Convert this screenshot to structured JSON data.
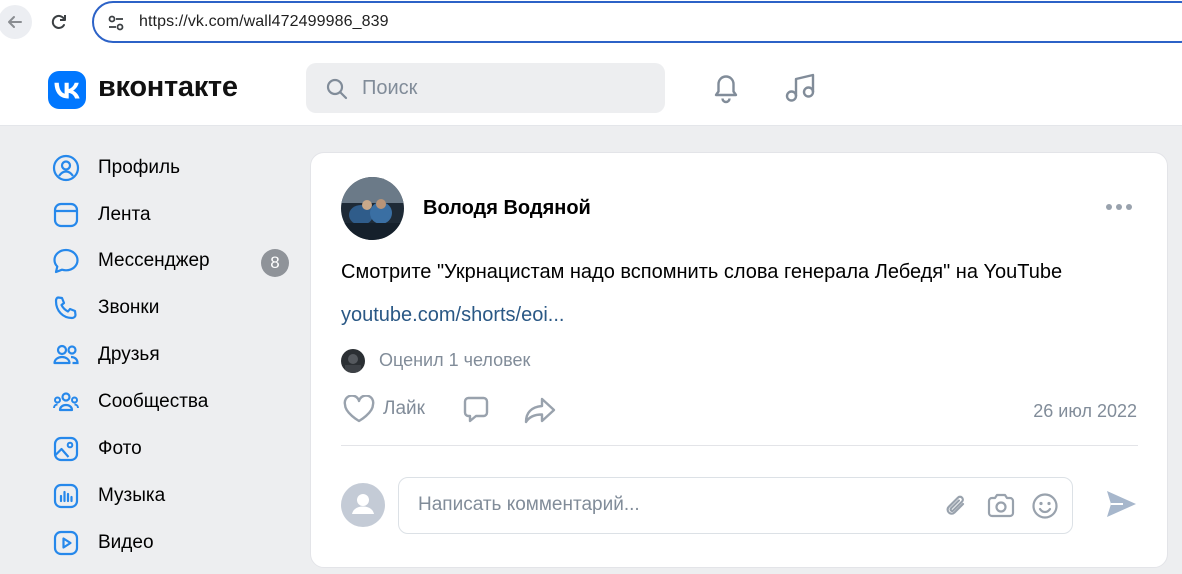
{
  "browser": {
    "url": "https://vk.com/wall472499986_839"
  },
  "header": {
    "brand": "вконтакте",
    "search_placeholder": "Поиск"
  },
  "sidebar": {
    "items": [
      {
        "label": "Профиль",
        "icon": "profile-icon"
      },
      {
        "label": "Лента",
        "icon": "feed-icon"
      },
      {
        "label": "Мессенджер",
        "icon": "messenger-icon",
        "badge": "8"
      },
      {
        "label": "Звонки",
        "icon": "phone-icon"
      },
      {
        "label": "Друзья",
        "icon": "friends-icon"
      },
      {
        "label": "Сообщества",
        "icon": "communities-icon"
      },
      {
        "label": "Фото",
        "icon": "photo-icon"
      },
      {
        "label": "Музыка",
        "icon": "music-icon"
      },
      {
        "label": "Видео",
        "icon": "video-icon"
      }
    ]
  },
  "post": {
    "author": "Володя Водяной",
    "text": "Смотрите \"Укрнацистам надо вспомнить слова генерала Лебедя\" на YouTube",
    "link": "youtube.com/shorts/eoi...",
    "liked_by": "Оценил 1 человек",
    "like_label": "Лайк",
    "date": "26 июл 2022",
    "comment_placeholder": "Написать комментарий..."
  },
  "colors": {
    "vk_blue": "#0077ff",
    "link": "#2a5885",
    "secondary_text": "#818c99",
    "icon_blue": "#2688eb",
    "background": "#edeef0"
  }
}
